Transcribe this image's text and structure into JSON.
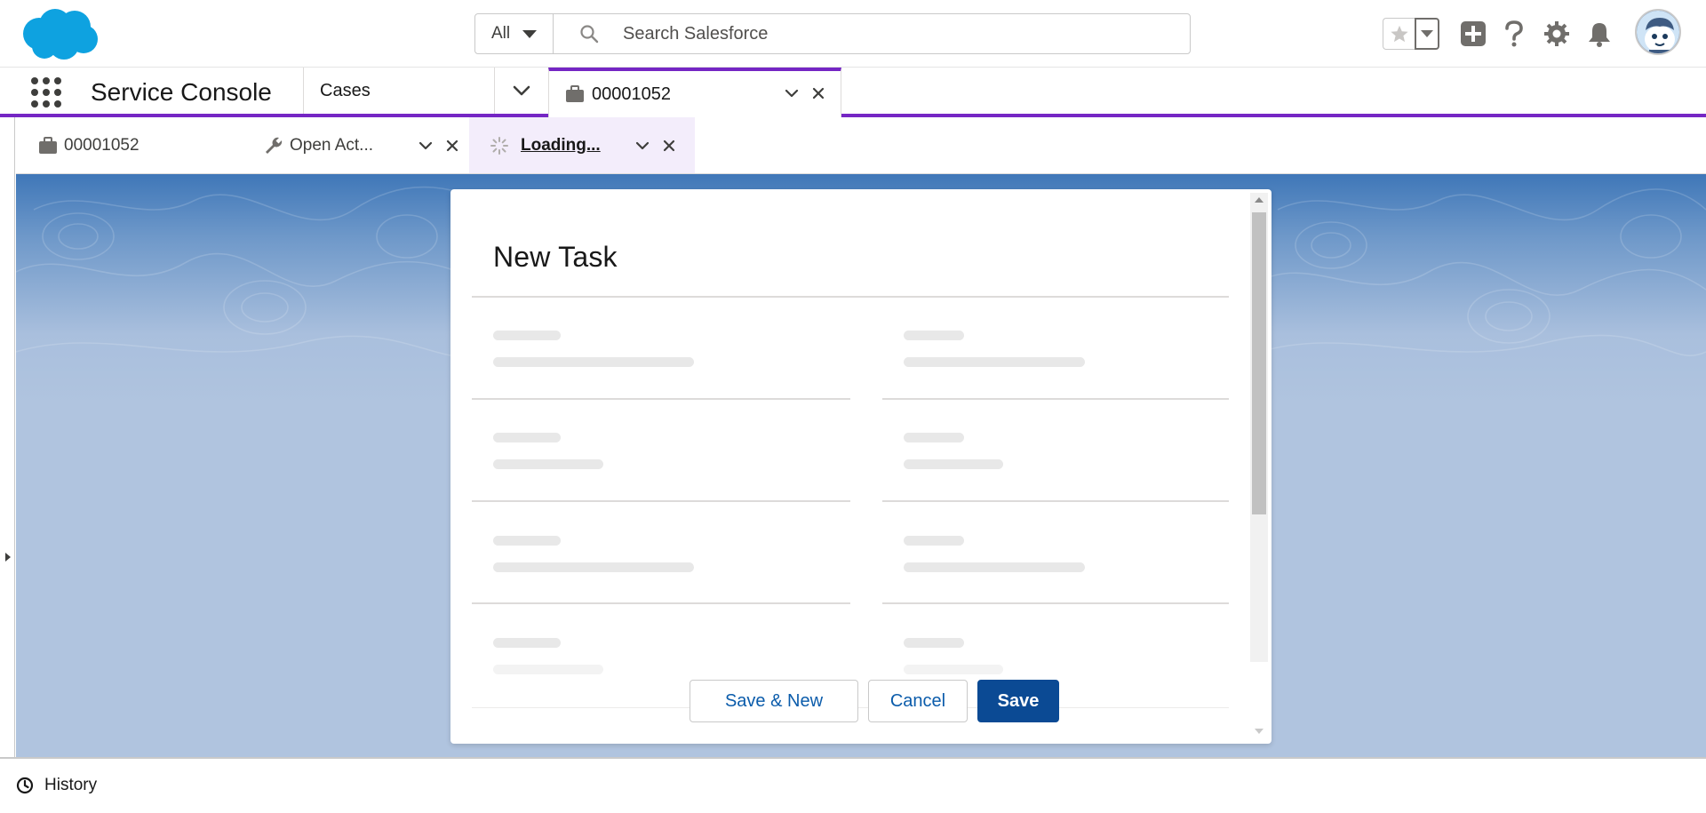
{
  "header": {
    "search_scope": "All",
    "search_placeholder": "Search Salesforce",
    "icons": [
      "salesforce-cloud-logo",
      "search-icon",
      "favorites-star-icon",
      "chevron-down-icon",
      "global-actions-plus-icon",
      "help-question-icon",
      "setup-gear-icon",
      "notifications-bell-icon",
      "user-avatar"
    ]
  },
  "nav": {
    "app_name": "Service Console",
    "items": [
      {
        "label": "Cases"
      }
    ],
    "workspace_tab": {
      "label": "00001052",
      "icon": "case-briefcase-icon"
    }
  },
  "subtabs": [
    {
      "label": "00001052",
      "icon": "case-briefcase-icon",
      "active": false
    },
    {
      "label": "Open Act...",
      "icon": "wrench-icon",
      "active": false
    },
    {
      "label": "Loading...",
      "icon": "spinner-icon",
      "active": true
    }
  ],
  "modal": {
    "title": "New Task",
    "state": "loading skeleton",
    "buttons": {
      "save_new": "Save & New",
      "cancel": "Cancel",
      "save": "Save"
    }
  },
  "utility_bar": {
    "items": [
      {
        "label": "History",
        "icon": "clock-icon"
      }
    ]
  },
  "colors": {
    "accent_purple": "#7526c4",
    "brand_button": "#0b4a94",
    "link_blue": "#0b5cab",
    "salesforce_cloud": "#1798c1"
  }
}
